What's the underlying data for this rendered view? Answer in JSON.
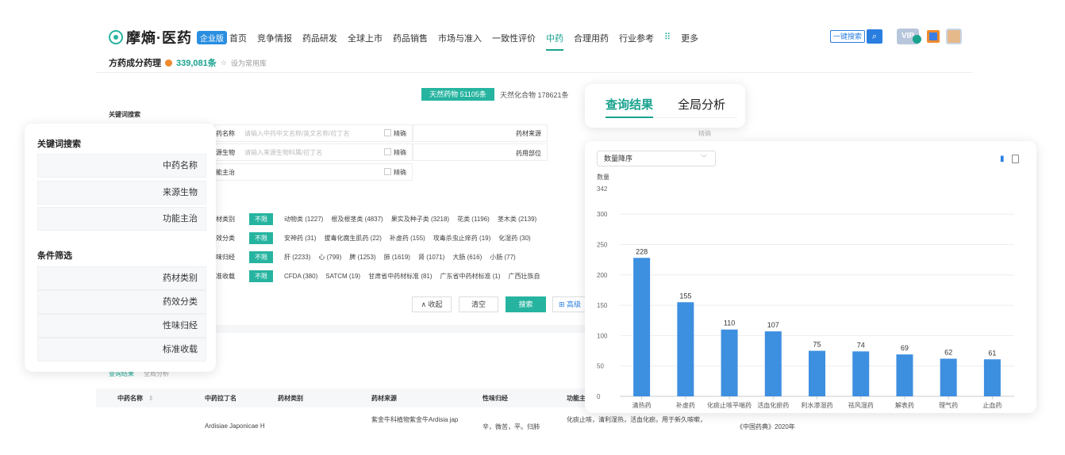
{
  "header": {
    "brand": "摩熵·医药",
    "edition_badge": "企业版",
    "nav": [
      "首页",
      "竞争情报",
      "药品研发",
      "全球上市",
      "药品销售",
      "市场与准入",
      "一致性评价",
      "中药",
      "合理用药",
      "行业参考",
      "更多"
    ],
    "nav_active_index": 7,
    "search_button": "一键搜索",
    "vip_label": "VIP"
  },
  "page": {
    "title": "方药成分药理",
    "count": "339,081条",
    "favorite": "设为常用库"
  },
  "source_tabs": {
    "natural": "天然药物 51105条",
    "compound": "天然化合物 178621条"
  },
  "form": {
    "keyword_title": "关键词搜索",
    "rows": [
      {
        "label": "药名称",
        "placeholder": "请输入中药中文名称/英文名称/拉丁名",
        "exact": "精确",
        "right_label": "药材来源"
      },
      {
        "label": "源生物",
        "placeholder": "请输入来源生物科属/拉丁名",
        "exact": "精确",
        "right_label": "药用部位"
      },
      {
        "label": "能主治",
        "placeholder": "",
        "exact": "精确",
        "right_label": ""
      }
    ],
    "right_exact": "精确",
    "filters": [
      {
        "label": "材类别",
        "no_limit": "不限",
        "options": [
          "动物类 (1227)",
          "根及根茎类 (4837)",
          "果实及种子类 (3218)",
          "花类 (1196)",
          "茎木类 (2139)"
        ]
      },
      {
        "label": "效分类",
        "no_limit": "不限",
        "options": [
          "安神药 (31)",
          "拔毒化腐生肌药 (22)",
          "补虚药 (155)",
          "攻毒杀虫止痒药 (19)",
          "化湿药 (30)"
        ]
      },
      {
        "label": "味归经",
        "no_limit": "不限",
        "options": [
          "肝 (2233)",
          "心 (799)",
          "脾 (1253)",
          "肺 (1619)",
          "肾 (1071)",
          "大肠 (616)",
          "小肠 (77)"
        ]
      },
      {
        "label": "准收载",
        "no_limit": "不限",
        "options": [
          "CFDA (380)",
          "SATCM (19)",
          "甘肃省中药材标准 (81)",
          "广东省中药材标准 (1)",
          "广西壮族自"
        ]
      }
    ],
    "buttons": {
      "collapse": "收起",
      "clear": "清空",
      "search": "搜索",
      "advanced": "高级"
    }
  },
  "results_tabs": {
    "query": "查询结果",
    "global": "全局分析"
  },
  "table": {
    "headers": [
      "中药名称",
      "中药拉丁名",
      "药材类别",
      "药材来源",
      "性味归经",
      "功能主"
    ],
    "row": {
      "latin": "Ardisiae Japonicae H",
      "source": "紫金牛科植物紫金牛Ardisia jap",
      "taste": "辛，微苦，平。归肺",
      "function": "化痰止咳，清利湿热，活血化瘀。用于新久咳嗽，",
      "standard": "《中国药典》2020年"
    }
  },
  "left_panel": {
    "keyword_title": "关键词搜索",
    "keyword_items": [
      "中药名称",
      "来源生物",
      "功能主治"
    ],
    "filter_title": "条件筛选",
    "filter_items": [
      "药材类别",
      "药效分类",
      "性味归经",
      "标准收载"
    ]
  },
  "chart_panel": {
    "sort_label": "数量降序",
    "icons": [
      "bar-chart-icon",
      "table-icon"
    ]
  },
  "chart_data": {
    "type": "bar",
    "ylabel": "数量",
    "ymax_label": "342",
    "ylim": [
      0,
      342
    ],
    "yticks": [
      0,
      50,
      100,
      150,
      200,
      250,
      300
    ],
    "categories": [
      "清热药",
      "补虚药",
      "化痰止咳平喘药",
      "活血化瘀药",
      "利水渗湿药",
      "祛风湿药",
      "解表药",
      "理气药",
      "止血药"
    ],
    "values": [
      228,
      155,
      110,
      107,
      75,
      74,
      69,
      62,
      61
    ],
    "bar_color": "#3d8fe0",
    "grid": true
  },
  "colors": {
    "accent": "#1aa38f",
    "blue": "#2a7ee0",
    "bar": "#3d8fe0"
  }
}
